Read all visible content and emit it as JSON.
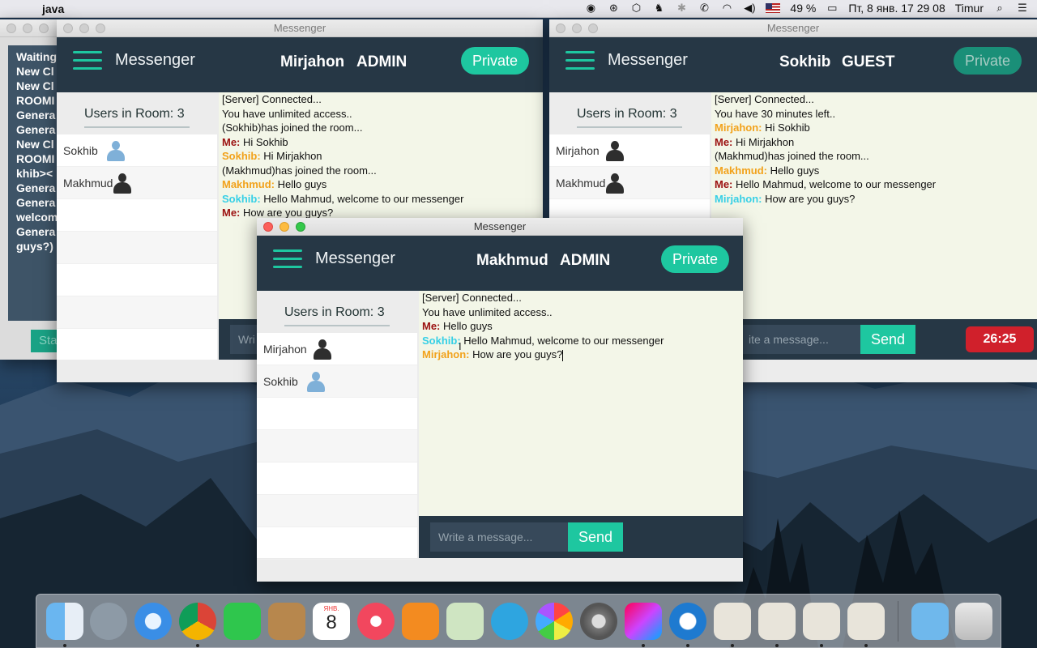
{
  "menubar": {
    "app_name": "java",
    "battery": "49 %",
    "datetime": "Пт, 8 янв.  17 29 08",
    "user": "Timur"
  },
  "console": {
    "lines": [
      "Waiting",
      "New Cl",
      "New Cl",
      "ROOMI",
      "Genera",
      "Genera",
      "New Cl",
      "ROOMI",
      "khib><",
      "Genera",
      "Genera",
      "welcom",
      "Genera",
      "guys?)"
    ],
    "start_fragment": "Sta"
  },
  "windows": {
    "left": {
      "title": "Messenger",
      "app_title": "Messenger",
      "user_name": "Mirjahon",
      "role": "ADMIN",
      "private_label": "Private",
      "room_label": "Users in Room: 3",
      "users": [
        "Sokhib",
        "Makhmud"
      ],
      "input_fragment": "Wri",
      "messages": [
        {
          "sender": "",
          "text": "[Server] Connected..."
        },
        {
          "sender": "",
          "text": "You have unlimited access.."
        },
        {
          "sender": "",
          "text": "(Sokhib)has joined the room..."
        },
        {
          "sender": "Me:",
          "text": " Hi Sokhib"
        },
        {
          "sender": "Sokhib:",
          "text": " Hi Mirjakhon"
        },
        {
          "sender": "",
          "text": "(Makhmud)has joined the room..."
        },
        {
          "sender": "Makhmud:",
          "text": " Hello guys"
        },
        {
          "sender": "Sokhib:",
          "text": " Hello Mahmud, welcome to our messenger"
        },
        {
          "sender": "Me:",
          "text": " How are you guys?"
        }
      ]
    },
    "right": {
      "title": "Messenger",
      "app_title": "Messenger",
      "user_name": "Sokhib",
      "role": "GUEST",
      "private_label": "Private",
      "room_label": "Users in Room: 3",
      "users": [
        "Mirjahon",
        "Makhmud"
      ],
      "input_placeholder": "ite a message...",
      "send_label": "Send",
      "timer": "26:25",
      "messages": [
        {
          "sender": "",
          "text": "[Server] Connected..."
        },
        {
          "sender": "",
          "text": "You have 30 minutes left.."
        },
        {
          "sender": "Mirjahon:",
          "text": " Hi Sokhib"
        },
        {
          "sender": "Me:",
          "text": " Hi Mirjakhon"
        },
        {
          "sender": "",
          "text": "(Makhmud)has joined the room..."
        },
        {
          "sender": "Makhmud:",
          "text": " Hello guys"
        },
        {
          "sender": "Me:",
          "text": " Hello Mahmud, welcome to our messenger"
        },
        {
          "sender": "Mirjahon:",
          "text": " How are you guys?"
        }
      ]
    },
    "front": {
      "title": "Messenger",
      "app_title": "Messenger",
      "user_name": "Makhmud",
      "role": "ADMIN",
      "private_label": "Private",
      "room_label": "Users in Room: 3",
      "users": [
        "Mirjahon",
        "Sokhib"
      ],
      "input_placeholder": "Write a message...",
      "send_label": "Send",
      "messages": [
        {
          "sender": "",
          "text": "[Server] Connected..."
        },
        {
          "sender": "",
          "text": "You have unlimited access.."
        },
        {
          "sender": "Me:",
          "text": " Hello guys"
        },
        {
          "sender": "Sokhib:",
          "text": " Hello Mahmud, welcome to our messenger"
        },
        {
          "sender": "Mirjahon:",
          "text": " How are you guys?"
        }
      ]
    }
  },
  "dock": {
    "calendar_month": "ЯНВ.",
    "calendar_day": "8"
  },
  "colors": {
    "header": "#263745",
    "accent": "#1ec7a0",
    "chat_bg": "#f3f6e8",
    "me": "#9b1010",
    "orange_sender": "#f2a21b",
    "cyan_sender": "#37d0e6",
    "timer": "#d0202b"
  }
}
